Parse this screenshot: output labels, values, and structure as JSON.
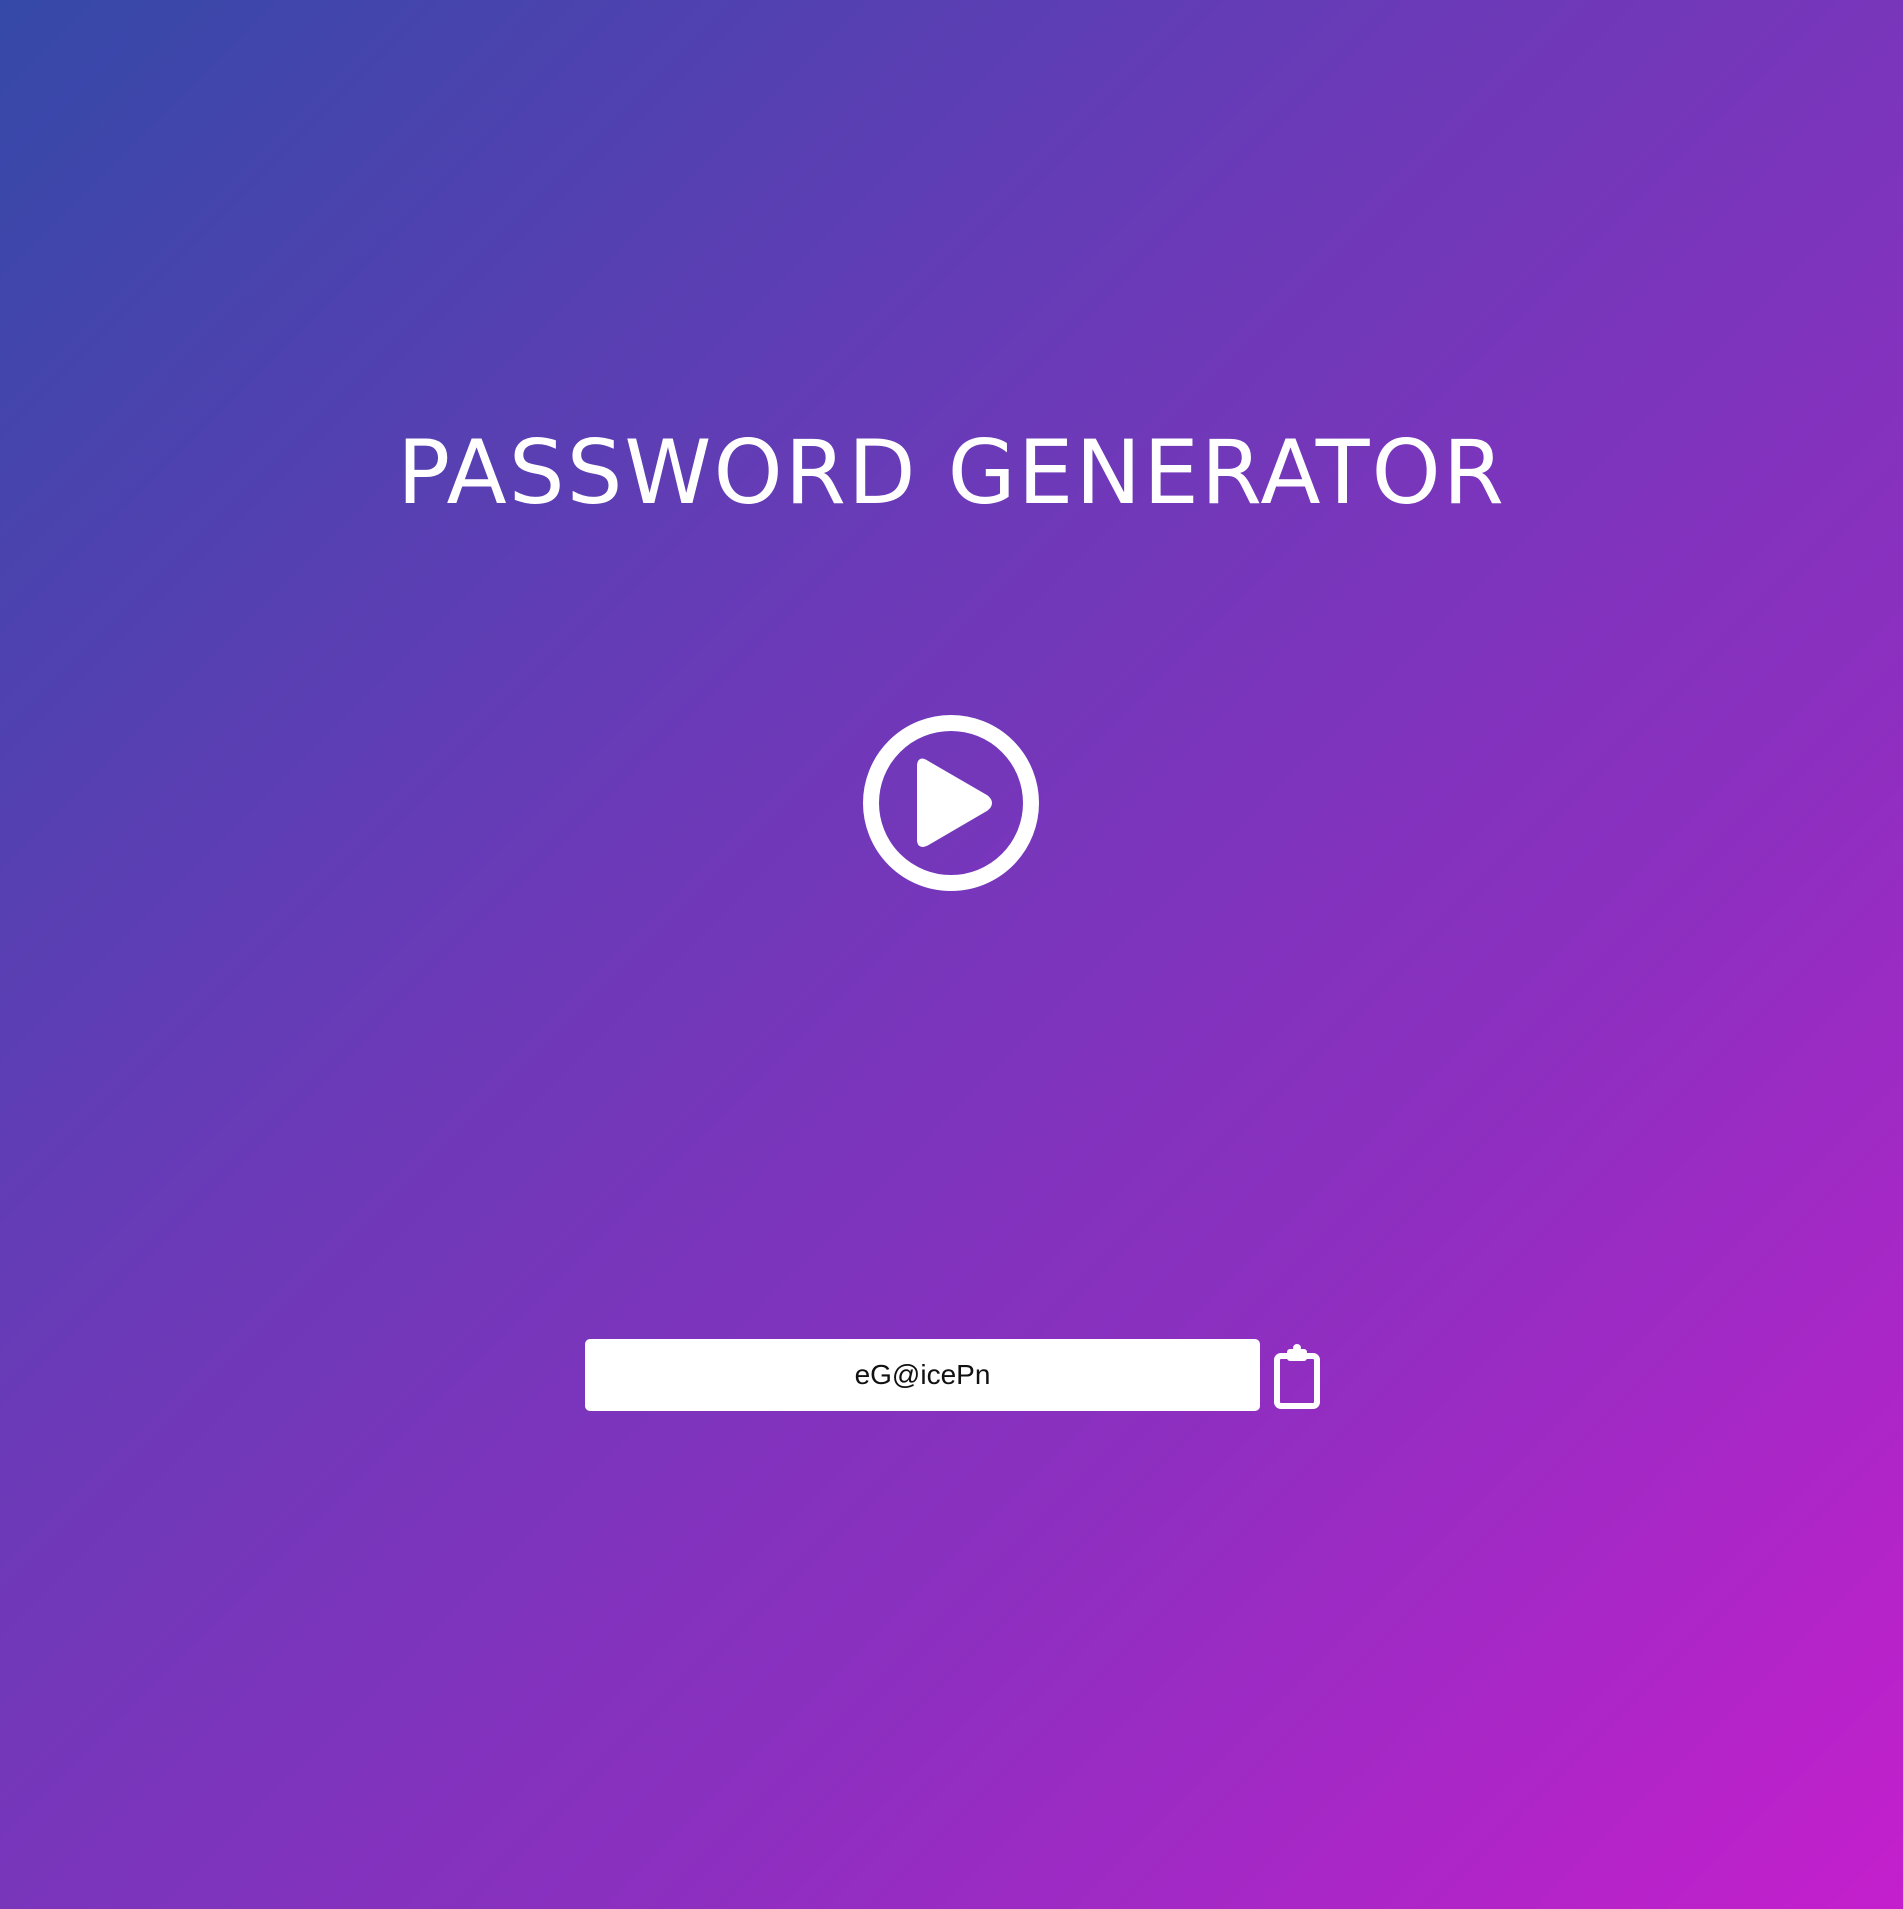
{
  "page": {
    "title": "PASSWORD GENERATOR"
  },
  "generator": {
    "generate_icon": "play-circle-icon",
    "password_value": "eG@icePn",
    "copy_icon": "clipboard-icon"
  },
  "colors": {
    "gradient_start": "#3549a8",
    "gradient_end": "#c41fcc",
    "foreground": "#ffffff",
    "field_text": "#111111"
  }
}
